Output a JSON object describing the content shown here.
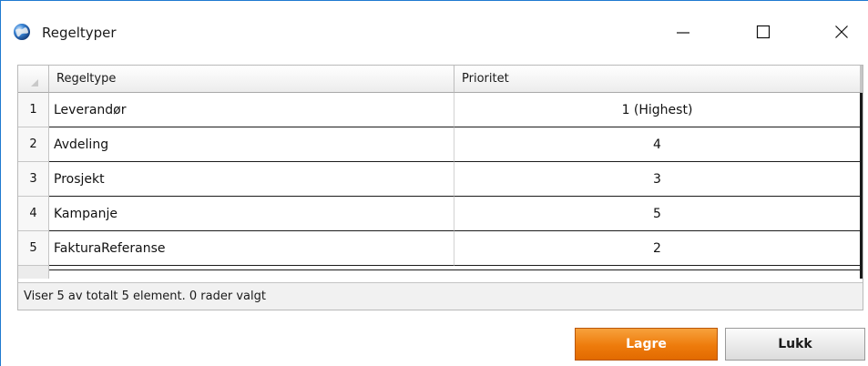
{
  "window": {
    "title": "Regeltyper",
    "controls": [
      "minimize",
      "maximize",
      "close"
    ]
  },
  "grid": {
    "columns": [
      "Regeltype",
      "Prioritet"
    ],
    "rows": [
      {
        "num": "1",
        "type": "Leverandør",
        "priority": "1 (Highest)"
      },
      {
        "num": "2",
        "type": "Avdeling",
        "priority": "4"
      },
      {
        "num": "3",
        "type": "Prosjekt",
        "priority": "3"
      },
      {
        "num": "4",
        "type": "Kampanje",
        "priority": "5"
      },
      {
        "num": "5",
        "type": "FakturaReferanse",
        "priority": "2"
      }
    ],
    "status": "Viser 5 av totalt 5 element. 0 rader valgt"
  },
  "buttons": {
    "save": "Lagre",
    "close": "Lukk"
  },
  "colors": {
    "accent_border": "#1f7ad0",
    "save_button": "#ee7b0c"
  }
}
